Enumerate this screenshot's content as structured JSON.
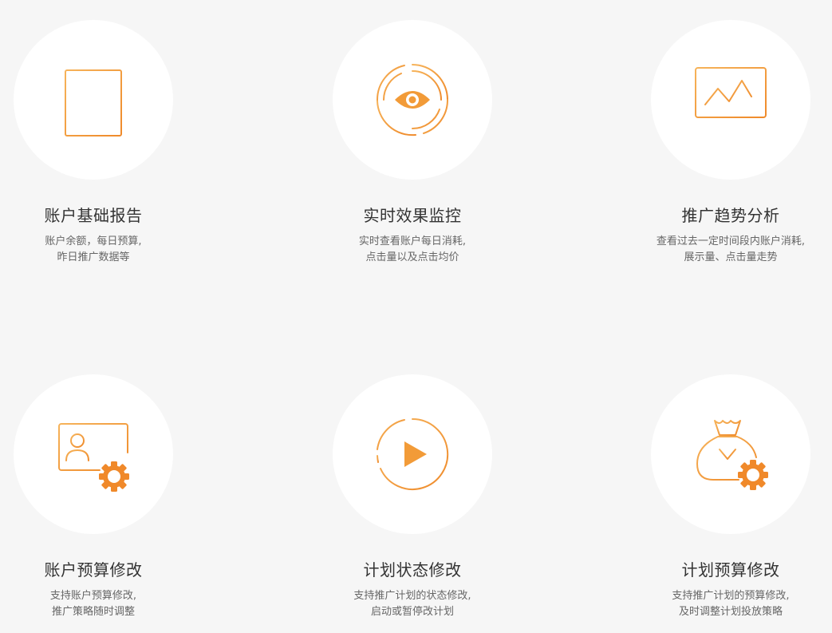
{
  "accent_color": "#f29b38",
  "features": [
    {
      "icon": "notepad-icon",
      "title": "账户基础报告",
      "desc_line1": "账户余额，每日预算,",
      "desc_line2": "昨日推广数据等"
    },
    {
      "icon": "eye-monitor-icon",
      "title": "实时效果监控",
      "desc_line1": "实时查看账户每日消耗,",
      "desc_line2": "点击量以及点击均价"
    },
    {
      "icon": "trend-monitor-icon",
      "title": "推广趋势分析",
      "desc_line1": "查看过去一定时间段内账户消耗,",
      "desc_line2": "展示量、点击量走势"
    },
    {
      "icon": "account-settings-icon",
      "title": "账户预算修改",
      "desc_line1": "支持账户预算修改,",
      "desc_line2": "推广策略随时调整"
    },
    {
      "icon": "play-icon",
      "title": "计划状态修改",
      "desc_line1": "支持推广计划的状态修改,",
      "desc_line2": "启动或暂停改计划"
    },
    {
      "icon": "money-bag-gear-icon",
      "title": "计划预算修改",
      "desc_line1": "支持推广计划的预算修改,",
      "desc_line2": "及时调整计划投放策略"
    }
  ]
}
